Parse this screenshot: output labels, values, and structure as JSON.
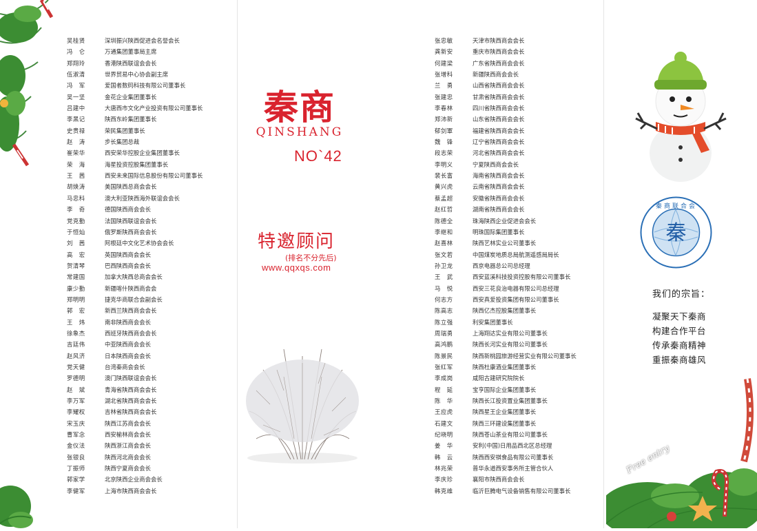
{
  "left_list": [
    {
      "name": "吴桂贤",
      "title": "深圳振兴陕西促进会名誉会长"
    },
    {
      "name": "冯　仑",
      "title": "万通集团董事局主席"
    },
    {
      "name": "郑翔玲",
      "title": "香港陕西联谊会会长"
    },
    {
      "name": "伍淑清",
      "title": "世界贸易中心协会副主席"
    },
    {
      "name": "冯　军",
      "title": "爱国者数码科技有限公司董事长"
    },
    {
      "name": "吴一坚",
      "title": "金花企业集团董事长"
    },
    {
      "name": "吕建中",
      "title": "大唐西市文化产业投资有限公司董事长"
    },
    {
      "name": "李黑记",
      "title": "陕西东岭集团董事长"
    },
    {
      "name": "史贵禄",
      "title": "荣民集团董事长"
    },
    {
      "name": "赵　涛",
      "title": "步长集团总裁"
    },
    {
      "name": "崔荣华",
      "title": "西安荣华控股企业集团董事长"
    },
    {
      "name": "荣　海",
      "title": "海星投资控股集团董事长"
    },
    {
      "name": "王　茜",
      "title": "西安未来国际信息股份有限公司董事长"
    },
    {
      "name": "胡焕涛",
      "title": "美国陕西总商会会长"
    },
    {
      "name": "马忠科",
      "title": "澳大利亚陕西海外联谊会会长"
    },
    {
      "name": "李　奇",
      "title": "德国陕西商会会长"
    },
    {
      "name": "党克勤",
      "title": "法国陕西联谊会会长"
    },
    {
      "name": "于恒灿",
      "title": "俄罗斯陕西商会会长"
    },
    {
      "name": "刘　茜",
      "title": "阿根廷中文化艺术协会会长"
    },
    {
      "name": "高　宏",
      "title": "英国陕西商会会长"
    },
    {
      "name": "贺清琴",
      "title": "巴西陕西商会会长"
    },
    {
      "name": "常建国",
      "title": "加拿大陕西总商会会长"
    },
    {
      "name": "康少勤",
      "title": "新疆喀什陕西商会会"
    },
    {
      "name": "郑明明",
      "title": "捷克华商联合会副会长"
    },
    {
      "name": "郭　宏",
      "title": "新西兰陕西商会会长"
    },
    {
      "name": "王　炜",
      "title": "南非陕西商会会长"
    },
    {
      "name": "徐象杰",
      "title": "西班牙陕西商会会长"
    },
    {
      "name": "吉廷伟",
      "title": "中亚陕西商会会长"
    },
    {
      "name": "赵风济",
      "title": "日本陕西商会会长"
    },
    {
      "name": "党天健",
      "title": "台湾秦商会会长"
    },
    {
      "name": "罗德明",
      "title": "澳门陕西联谊会会长"
    },
    {
      "name": "赵　斌",
      "title": "青海省陕西商会会长"
    },
    {
      "name": "李万军",
      "title": "湖北省陕西商会会长"
    },
    {
      "name": "李耀权",
      "title": "吉林省陕西商会会长"
    },
    {
      "name": "宋玉庆",
      "title": "陕西江苏商会会长"
    },
    {
      "name": "曹军念",
      "title": "西安榆林商会会长"
    },
    {
      "name": "金仪法",
      "title": "陕西浙江商会会长"
    },
    {
      "name": "张银良",
      "title": "陕西河北商会会长"
    },
    {
      "name": "丁振师",
      "title": "陕西宁夏商会会长"
    },
    {
      "name": "郭家学",
      "title": "北京陕西企业商会会长"
    },
    {
      "name": "李健军",
      "title": "上海市陕西商会会长"
    }
  ],
  "right_list": [
    {
      "name": "张忠敏",
      "title": "天津市陕西商会会长"
    },
    {
      "name": "龚新安",
      "title": "重庆市陕西商会会长"
    },
    {
      "name": "何建梁",
      "title": "广东省陕西商会会长"
    },
    {
      "name": "张增科",
      "title": "新疆陕西商会会长"
    },
    {
      "name": "兰　勇",
      "title": "山西省陕西商会会长"
    },
    {
      "name": "张建忠",
      "title": "甘肃省陕西商会会长"
    },
    {
      "name": "李春林",
      "title": "四川省陕西商会会长"
    },
    {
      "name": "郑沛新",
      "title": "山东省陕西商会会长"
    },
    {
      "name": "郁剑軍",
      "title": "福建省陕西商会会长"
    },
    {
      "name": "魏　锋",
      "title": "辽宁省陕西商会会长"
    },
    {
      "name": "段志荣",
      "title": "河北省陕西商会会长"
    },
    {
      "name": "李明义",
      "title": "宁夏陕西商会会长"
    },
    {
      "name": "裴长富",
      "title": "海南省陕西商会会长"
    },
    {
      "name": "黄兴虎",
      "title": "云南省陕西商会会长"
    },
    {
      "name": "蔡孟超",
      "title": "安徽省陕西商会会长"
    },
    {
      "name": "赵红哲",
      "title": "湖南省陕西商会会长"
    },
    {
      "name": "陈德全",
      "title": "珠海陕西企业促进会会长"
    },
    {
      "name": "李继和",
      "title": "明珠国际集团董事长"
    },
    {
      "name": "赵喜林",
      "title": "陕西艺林实业公司董事长"
    },
    {
      "name": "张文若",
      "title": "中国煤炭地质总局航测遥感局局长"
    },
    {
      "name": "孙卫龙",
      "title": "西京电器总公司总经理"
    },
    {
      "name": "王　武",
      "title": "西安蓝溪科技投资控股有限公司董事长"
    },
    {
      "name": "马　悦",
      "title": "西安三花良治电器有限公司总经理"
    },
    {
      "name": "何志方",
      "title": "西安真爱投资集团有限公司董事长"
    },
    {
      "name": "陈高志",
      "title": "陕西亿杰控股集团董事长"
    },
    {
      "name": "陈立强",
      "title": "利安集团董事长"
    },
    {
      "name": "周瑞勇",
      "title": "上海翔达实业有限公司董事长"
    },
    {
      "name": "高鸿鹏",
      "title": "陕西长河实业有限公司董事长"
    },
    {
      "name": "陈景民",
      "title": "陕西新桃园旅游经营实业有限公司董事长"
    },
    {
      "name": "张红军",
      "title": "陕西杜康酒业集团董事长"
    },
    {
      "name": "李成岗",
      "title": "咸阳古建研究院院长"
    },
    {
      "name": "程　延",
      "title": "宝亨国际企业集团董事长"
    },
    {
      "name": "陈　华",
      "title": "陕西长江投资置业集团董事长"
    },
    {
      "name": "王应虎",
      "title": "陕西星王企业集团董事长"
    },
    {
      "name": "石建文",
      "title": "陕西三环建设集团董事长"
    },
    {
      "name": "纪晓明",
      "title": "陕西苍山茶业有限公司董事长"
    },
    {
      "name": "姜　华",
      "title": "安利(中国)日用品西北区总经理"
    },
    {
      "name": "韩　云",
      "title": "陕西西安祺食品有限公司董事长"
    },
    {
      "name": "林兆荣",
      "title": "普华永道西安事务所主管合伙人"
    },
    {
      "name": "李庆珍",
      "title": "襄阳市陕西商会会长"
    },
    {
      "name": "韩克维",
      "title": "临沂巨腾电气设备销售有限公司董事长"
    }
  ],
  "brand": {
    "cn": "秦商",
    "en": "QINSHANG",
    "issue": "NO`42"
  },
  "advisor": {
    "title": "特邀顾问",
    "note": "(排名不分先后)",
    "url": "www.qqxqs.com"
  },
  "motto": {
    "heading": "我们的宗旨：",
    "lines": [
      "凝聚天下秦商",
      "构建合作平台",
      "传承秦商精神",
      "重振秦商雄风"
    ]
  },
  "emblem_ring_text": "秦商联合会",
  "free_entry_text": "Free entry",
  "colors": {
    "brand_red": "#d9232e",
    "pine": "#2f7d2a",
    "snowman_hat": "#8cc43f",
    "scarf": "#e44c2a"
  }
}
